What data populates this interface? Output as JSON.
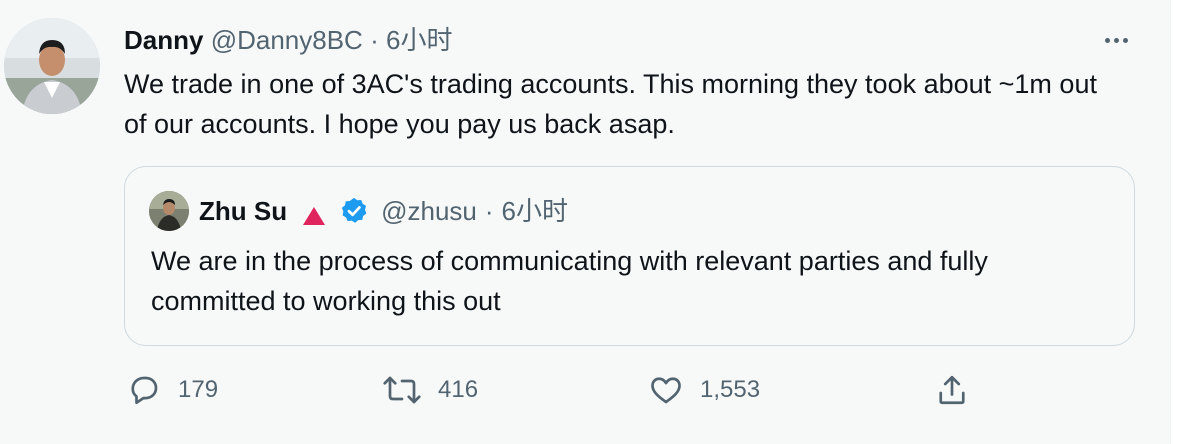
{
  "tweet": {
    "author_name": "Danny",
    "author_handle": "@Danny8BC",
    "separator": "·",
    "time": "6小时",
    "text": "We trade in one of 3AC's trading accounts. This morning they took about ~1m out of our accounts. I hope you pay us back asap."
  },
  "quoted": {
    "author_name": "Zhu Su",
    "author_handle": "@zhusu",
    "separator": "·",
    "time": "6小时",
    "text": "We are in the process of communicating with relevant parties and fully committed to working this out"
  },
  "actions": {
    "replies": "179",
    "retweets": "416",
    "likes": "1,553"
  },
  "icons": {
    "more": "more-icon",
    "reply": "reply-icon",
    "retweet": "retweet-icon",
    "like": "heart-icon",
    "share": "share-icon",
    "verified": "verified-badge-icon",
    "flag": "red-triangle-icon"
  },
  "colors": {
    "text": "#0f1419",
    "secondary": "#536471",
    "verified": "#1d9bf0",
    "triangle": "#e0245e",
    "border": "#cfd9de",
    "background": "#f7f9f9"
  }
}
